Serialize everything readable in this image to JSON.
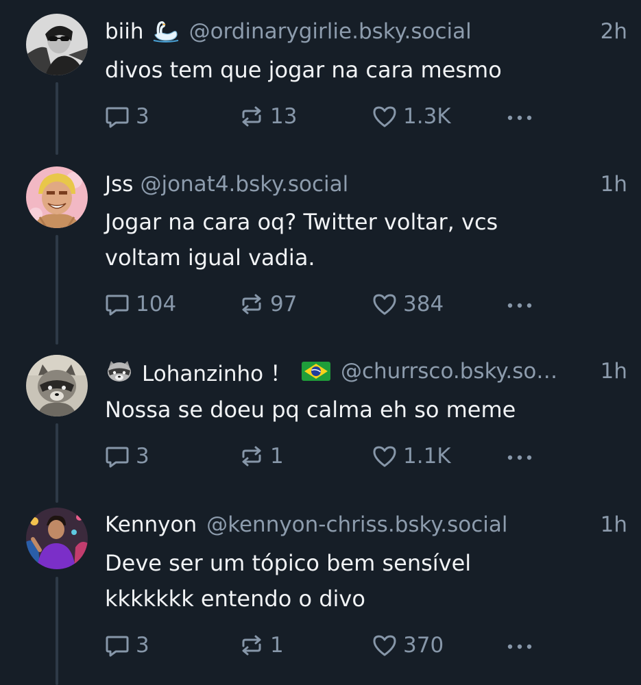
{
  "posts": [
    {
      "name": "biih",
      "handle": "@ordinarygirlie.bsky.social",
      "time": "2h",
      "text_lines": [
        "divos tem que jogar na cara mesmo"
      ],
      "replies": "3",
      "reposts": "13",
      "likes": "1.3K",
      "avatar_icon": "woman-sunglasses-avatar",
      "name_icon": "swan-emoji"
    },
    {
      "name": "Jss",
      "handle": "@jonat4.bsky.social",
      "time": "1h",
      "text_lines": [
        "Jogar na cara oq? Twitter voltar, vcs",
        "voltam igual vadia."
      ],
      "replies": "104",
      "reposts": "97",
      "likes": "384",
      "avatar_icon": "anime-character-avatar"
    },
    {
      "name": "Lohanzinho ！",
      "handle": "@churrsco.bsky.so…",
      "time": "1h",
      "text_lines": [
        "Nossa se doeu pq calma eh so meme"
      ],
      "replies": "3",
      "reposts": "1",
      "likes": "1.1K",
      "avatar_icon": "raccoon-avatar",
      "name_icons": [
        "raccoon-emoji",
        "brazil-flag-emoji"
      ]
    },
    {
      "name": "Kennyon",
      "handle": "@kennyon-chriss.bsky.social",
      "time": "1h",
      "text_lines": [
        "Deve ser um tópico bem sensível",
        "kkkkkkk entendo o divo"
      ],
      "replies": "3",
      "reposts": "1",
      "likes": "370",
      "avatar_icon": "man-purple-shirt-avatar"
    }
  ],
  "colors": {
    "background": "#161e27",
    "text": "#f1f3f5",
    "muted": "#8d9cad",
    "thread_line": "#2e3a47"
  }
}
